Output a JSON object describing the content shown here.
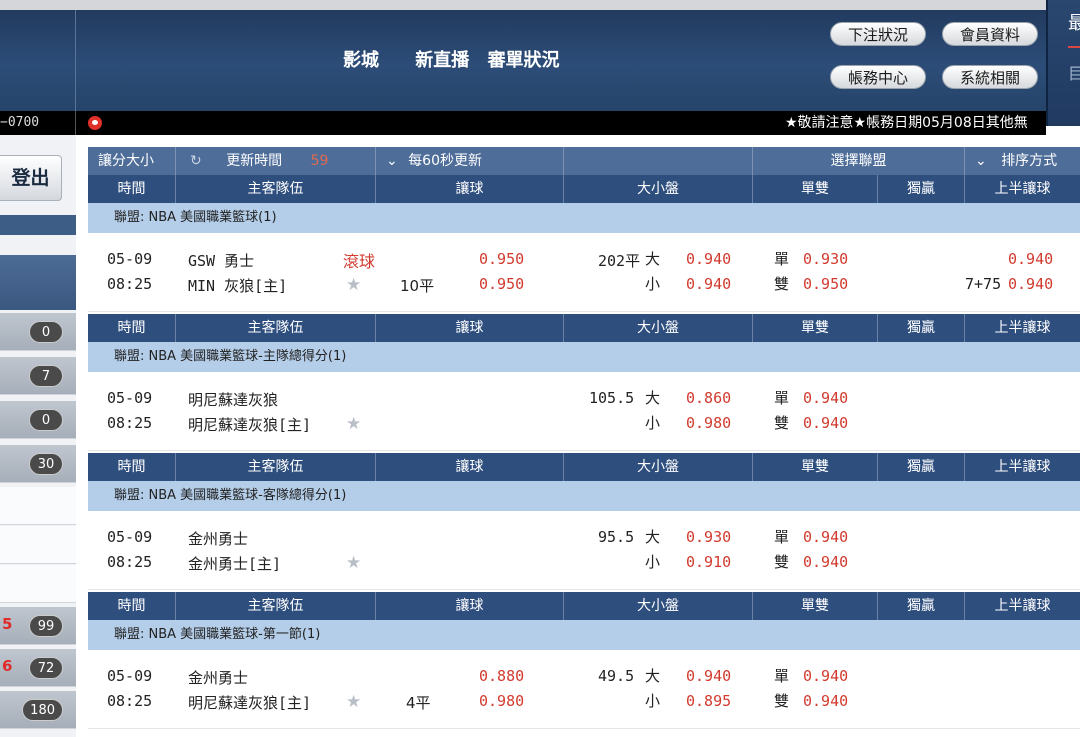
{
  "header": {
    "nav": [
      "影城",
      "新直播",
      "審單狀況"
    ],
    "buttons": {
      "bet_status": "下注狀況",
      "member_info": "會員資料",
      "account_center": "帳務中心",
      "system": "系統相關"
    },
    "right_title": "最",
    "right_sub": "目"
  },
  "marquee": {
    "left_text": "−0700",
    "message": "★敬請注意★帳務日期05月08日其他無"
  },
  "sidebar": {
    "logout": "登出",
    "badges": [
      {
        "prefix": "",
        "value": "0"
      },
      {
        "prefix": "",
        "value": "7"
      },
      {
        "prefix": "",
        "value": "0"
      },
      {
        "prefix": "",
        "value": "30"
      },
      {
        "prefix": "5",
        "value": "99"
      },
      {
        "prefix": "6",
        "value": "72"
      },
      {
        "prefix": "",
        "value": "180"
      }
    ]
  },
  "toolbar": {
    "handicap_label": "讓分大小",
    "refresh_icon": "↻",
    "update_time_label": "更新時間",
    "countdown": "59",
    "auto_refresh": "每60秒更新",
    "select_league": "選擇聯盟",
    "sort_by": "排序方式",
    "chevron": "⌄"
  },
  "columns": [
    "時間",
    "主客隊伍",
    "讓球",
    "大小盤",
    "單雙",
    "獨贏",
    "上半讓球"
  ],
  "sections": [
    {
      "league": "聯盟: NBA 美國職業籃球(1)",
      "game": {
        "date": "05-09",
        "time": "08:25",
        "team1": "GSW 勇士",
        "team2": "MIN 灰狼[主]",
        "live": "滾球",
        "handicap_line": "10平",
        "handicap_odds1": "0.950",
        "handicap_odds2": "0.950",
        "ou_line": "202平",
        "ou_over": "大",
        "ou_under": "小",
        "ou_odds1": "0.940",
        "ou_odds2": "0.940",
        "oe_odd": "單",
        "oe_even": "雙",
        "oe_odds1": "0.930",
        "oe_odds2": "0.950",
        "half_line": "7+75",
        "half_odds1": "0.940",
        "half_odds2": "0.940"
      }
    },
    {
      "league": "聯盟: NBA 美國職業籃球-主隊總得分(1)",
      "game": {
        "date": "05-09",
        "time": "08:25",
        "team1": "明尼蘇達灰狼",
        "team2": "明尼蘇達灰狼[主]",
        "ou_line": "105.5",
        "ou_over": "大",
        "ou_under": "小",
        "ou_odds1": "0.860",
        "ou_odds2": "0.980",
        "oe_odd": "單",
        "oe_even": "雙",
        "oe_odds1": "0.940",
        "oe_odds2": "0.940"
      }
    },
    {
      "league": "聯盟: NBA 美國職業籃球-客隊總得分(1)",
      "game": {
        "date": "05-09",
        "time": "08:25",
        "team1": "金州勇士",
        "team2": "金州勇士[主]",
        "ou_line": "95.5",
        "ou_over": "大",
        "ou_under": "小",
        "ou_odds1": "0.930",
        "ou_odds2": "0.910",
        "oe_odd": "單",
        "oe_even": "雙",
        "oe_odds1": "0.940",
        "oe_odds2": "0.940"
      }
    },
    {
      "league": "聯盟: NBA 美國職業籃球-第一節(1)",
      "game": {
        "date": "05-09",
        "time": "08:25",
        "team1": "金州勇士",
        "team2": "明尼蘇達灰狼[主]",
        "handicap_line": "4平",
        "handicap_odds1": "0.880",
        "handicap_odds2": "0.980",
        "ou_line": "49.5",
        "ou_over": "大",
        "ou_under": "小",
        "ou_odds1": "0.940",
        "ou_odds2": "0.895",
        "oe_odd": "單",
        "oe_even": "雙",
        "oe_odds1": "0.940",
        "oe_odds2": "0.940"
      }
    }
  ],
  "colors": {
    "header": "#2c4d78",
    "odds": "#d23a2e",
    "league_bg": "#b4cde8",
    "col_header": "#2e4e7e"
  },
  "icons": {
    "star": "star-icon",
    "refresh": "refresh-icon",
    "chevron": "chevron-down-icon",
    "announce": "announcement-icon"
  }
}
